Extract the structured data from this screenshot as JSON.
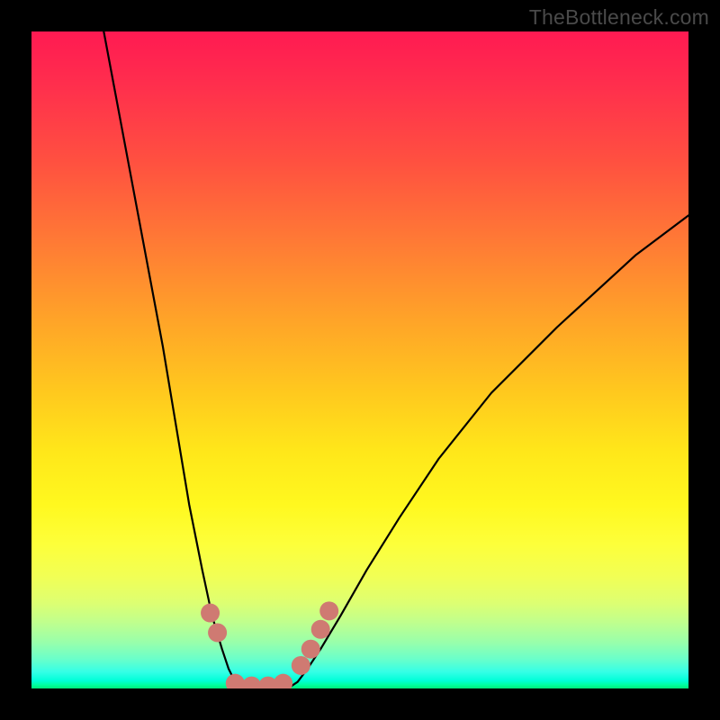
{
  "watermark": "TheBottleneck.com",
  "chart_data": {
    "type": "line",
    "title": "",
    "xlabel": "",
    "ylabel": "",
    "xlim": [
      0,
      100
    ],
    "ylim": [
      0,
      100
    ],
    "grid": false,
    "legend": null,
    "background": "red-yellow-green vertical gradient",
    "series": [
      {
        "name": "left-branch",
        "x": [
          11,
          14,
          17,
          20,
          22,
          24,
          26,
          27.5,
          29,
          30,
          31,
          32.5
        ],
        "y": [
          100,
          84,
          68,
          52,
          40,
          28,
          18,
          11,
          6,
          3,
          1,
          0
        ]
      },
      {
        "name": "right-branch",
        "x": [
          39,
          40.5,
          42,
          44,
          47,
          51,
          56,
          62,
          70,
          80,
          92,
          100
        ],
        "y": [
          0,
          1,
          3,
          6,
          11,
          18,
          26,
          35,
          45,
          55,
          66,
          72
        ]
      },
      {
        "name": "floor",
        "x": [
          32.5,
          39
        ],
        "y": [
          0,
          0
        ]
      }
    ],
    "markers": [
      {
        "name": "left-marker-upper",
        "x": 27.2,
        "y": 11.5
      },
      {
        "name": "left-marker-lower",
        "x": 28.3,
        "y": 8.5
      },
      {
        "name": "floor-marker-1",
        "x": 31.0,
        "y": 0.8
      },
      {
        "name": "floor-marker-2",
        "x": 33.5,
        "y": 0.4
      },
      {
        "name": "floor-marker-3",
        "x": 36.0,
        "y": 0.4
      },
      {
        "name": "floor-marker-4",
        "x": 38.3,
        "y": 0.8
      },
      {
        "name": "right-marker-1",
        "x": 41.0,
        "y": 3.5
      },
      {
        "name": "right-marker-2",
        "x": 42.5,
        "y": 6.0
      },
      {
        "name": "right-marker-3",
        "x": 44.0,
        "y": 9.0
      },
      {
        "name": "right-marker-4",
        "x": 45.3,
        "y": 11.8
      }
    ],
    "marker_color": "#cf7a72",
    "curve_color": "#000000"
  }
}
